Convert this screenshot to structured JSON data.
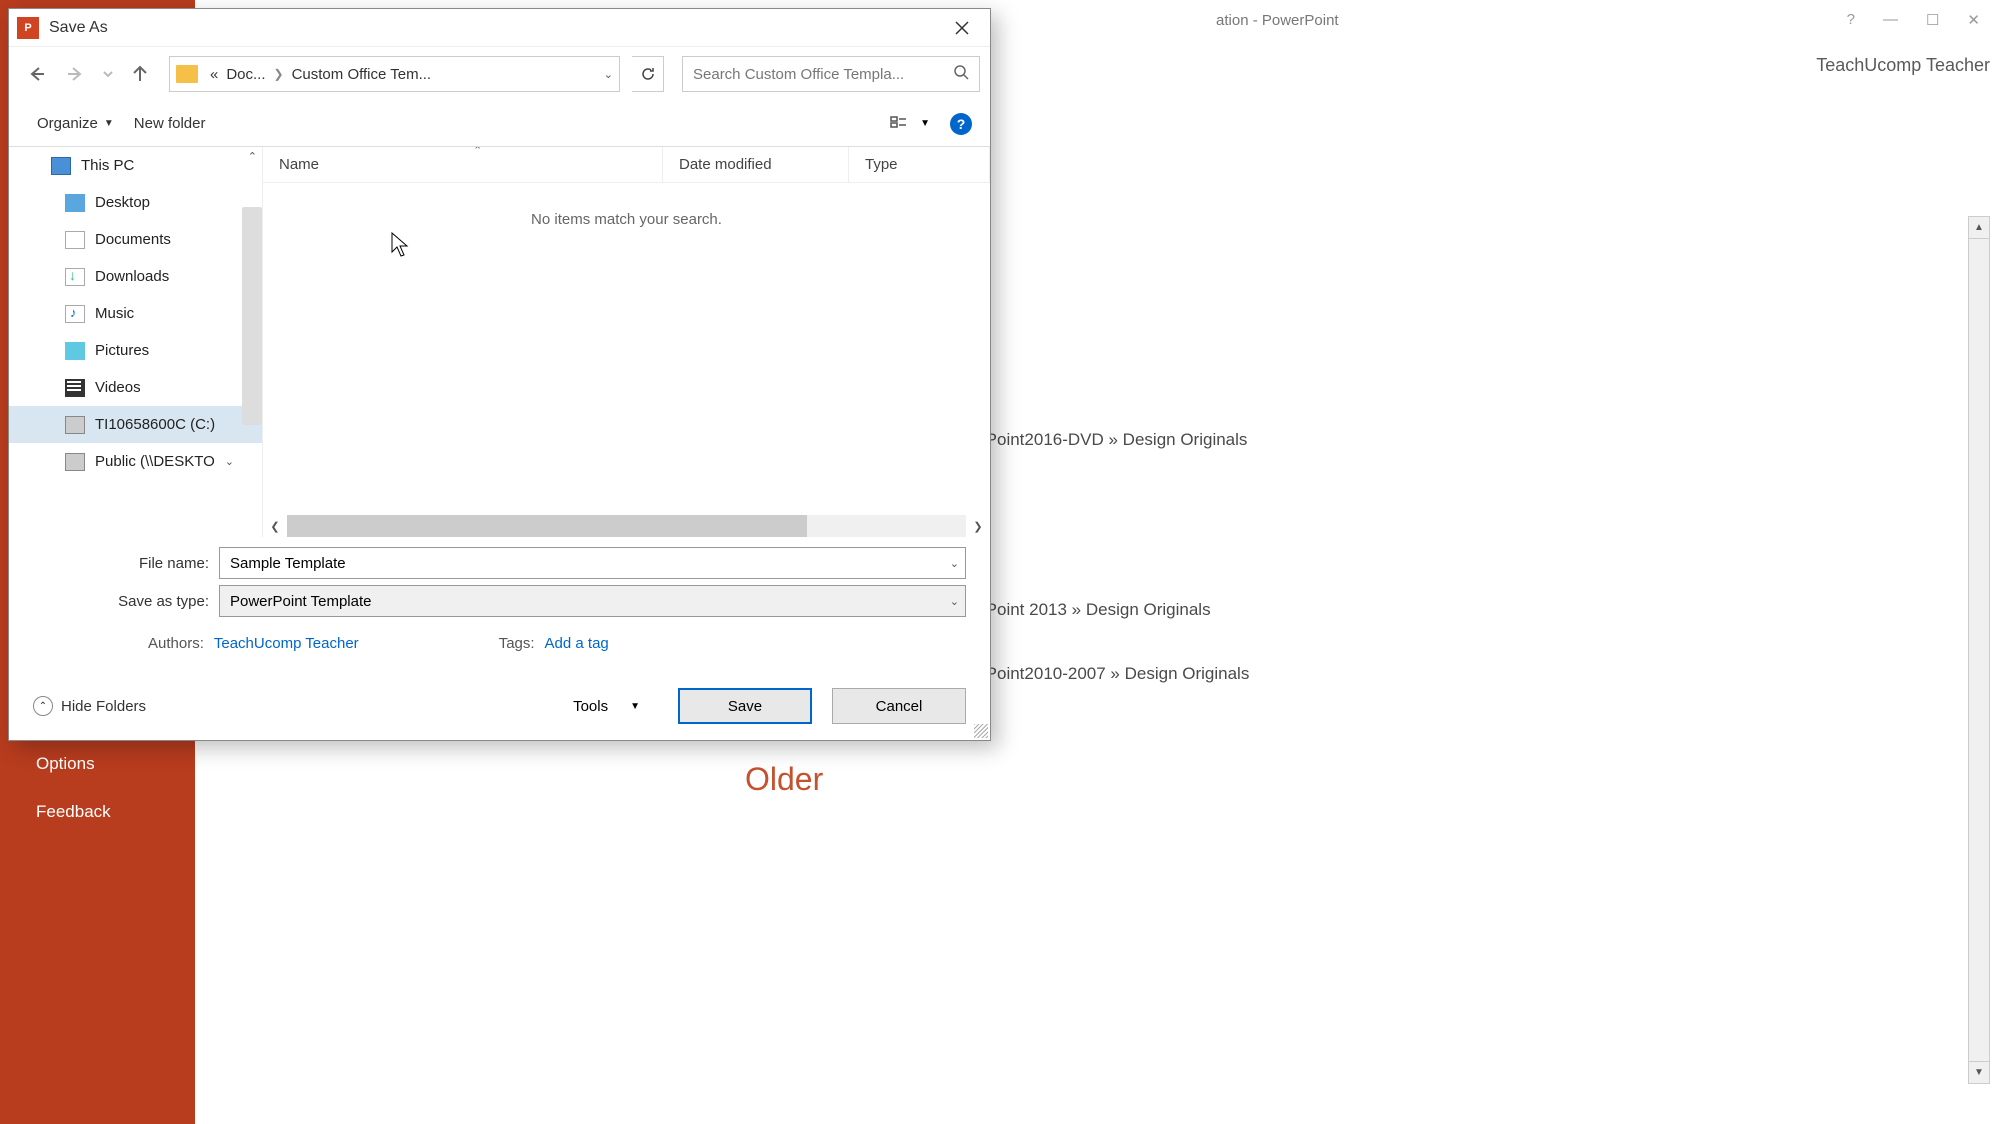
{
  "ppt": {
    "title_suffix": "ation - PowerPoint",
    "help": "?",
    "user": "TeachUcomp Teacher",
    "sidebar": {
      "options": "Options",
      "feedback": "Feedback"
    },
    "paths": {
      "p1": "rPoint2016-DVD » Design Originals",
      "p2": "rPoint 2013 » Design Originals",
      "p3": "rPoint2010-2007 » Design Originals"
    },
    "older": "Older"
  },
  "dialog": {
    "title": "Save As",
    "breadcrumb": {
      "pre": "«",
      "p1": "Doc...",
      "p2": "Custom Office Tem..."
    },
    "search_placeholder": "Search Custom Office Templa...",
    "toolbar": {
      "organize": "Organize",
      "new_folder": "New folder"
    },
    "columns": {
      "name": "Name",
      "date": "Date modified",
      "type": "Type"
    },
    "empty": "No items match your search.",
    "tree": {
      "this_pc": "This PC",
      "desktop": "Desktop",
      "documents": "Documents",
      "downloads": "Downloads",
      "music": "Music",
      "pictures": "Pictures",
      "videos": "Videos",
      "drive_c": "TI10658600C (C:)",
      "public": "Public (\\\\DESKTO"
    },
    "filename_label": "File name:",
    "filename_value": "Sample Template",
    "savetype_label": "Save as type:",
    "savetype_value": "PowerPoint Template",
    "authors_label": "Authors:",
    "authors_value": "TeachUcomp Teacher",
    "tags_label": "Tags:",
    "tags_value": "Add a tag",
    "hide_folders": "Hide Folders",
    "tools": "Tools",
    "save": "Save",
    "cancel": "Cancel"
  }
}
